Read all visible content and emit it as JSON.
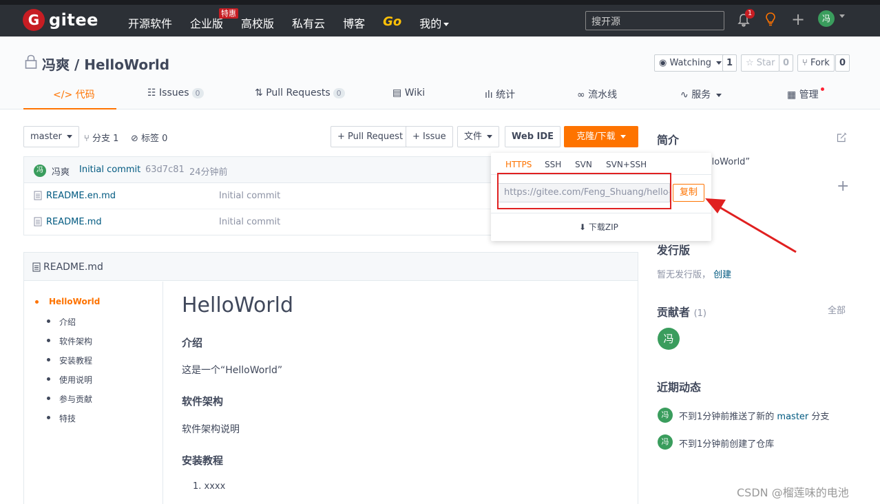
{
  "header": {
    "logo_letter": "G",
    "logo_text": "gitee",
    "nav": [
      "开源软件",
      "企业版",
      "高校版",
      "私有云",
      "博客",
      "Go",
      "我的"
    ],
    "special_badge": "特惠",
    "search_placeholder": "搜开源",
    "notification_count": "1",
    "avatar_letter": "冯"
  },
  "repo": {
    "title": "冯爽 / HelloWorld",
    "watching_label": "Watching",
    "watching_count": "1",
    "star_label": "Star",
    "star_count": "0",
    "fork_label": "Fork",
    "fork_count": "0",
    "tabs": [
      {
        "icon": "</>",
        "label": "代码"
      },
      {
        "icon": "",
        "label": "Issues",
        "count": "0"
      },
      {
        "icon": "",
        "label": "Pull Requests",
        "count": "0"
      },
      {
        "icon": "",
        "label": "Wiki"
      },
      {
        "icon": "",
        "label": "统计"
      },
      {
        "icon": "",
        "label": "流水线"
      },
      {
        "icon": "",
        "label": "服务"
      },
      {
        "icon": "",
        "label": "管理"
      }
    ]
  },
  "toolbar": {
    "branch": "master",
    "branches": "分支 1",
    "tags": "标签 0",
    "pull_request": "+ Pull Request",
    "issue": "+ Issue",
    "file": "文件",
    "web_ide": "Web IDE",
    "clone": "克隆/下载"
  },
  "commit": {
    "avatar": "冯",
    "author": "冯爽",
    "message": "Initial commit",
    "hash": "63d7c81",
    "time": "24分钟前"
  },
  "files": [
    {
      "name": "README.en.md",
      "message": "Initial commit"
    },
    {
      "name": "README.md",
      "message": "Initial commit"
    }
  ],
  "clone_dropdown": {
    "tabs": [
      "HTTPS",
      "SSH",
      "SVN",
      "SVN+SSH"
    ],
    "url": "https://gitee.com/Feng_Shuang/hello-world.git",
    "copy_label": "复制",
    "zip_label": "下载ZIP"
  },
  "readme": {
    "title": "README.md",
    "toc": [
      "HelloWorld",
      "介绍",
      "软件架构",
      "安装教程",
      "使用说明",
      "参与贡献",
      "特技"
    ],
    "h1": "HelloWorld",
    "sec1_title": "介绍",
    "sec1_text": "这是一个“HelloWorld”",
    "sec2_title": "软件架构",
    "sec2_text": "软件架构说明",
    "sec3_title": "安装教程",
    "list_item1": "1. xxxx"
  },
  "sidebar": {
    "intro_title": "简介",
    "intro_text": "lloWorld”",
    "release_title": "发行版",
    "release_text": "暂无发行版，",
    "release_link": "创建",
    "contrib_title": "贡献者",
    "contrib_count": "(1)",
    "contrib_all": "全部",
    "contrib_avatar": "冯",
    "activity_title": "近期动态",
    "activities": [
      {
        "avatar": "冯",
        "pre": "不到1分钟前推送了新的",
        "link": "master",
        "post": "分支"
      },
      {
        "avatar": "冯",
        "pre": "不到1分钟前创建了仓库",
        "link": "",
        "post": ""
      }
    ]
  },
  "watermark": "CSDN @榴莲味的电池"
}
